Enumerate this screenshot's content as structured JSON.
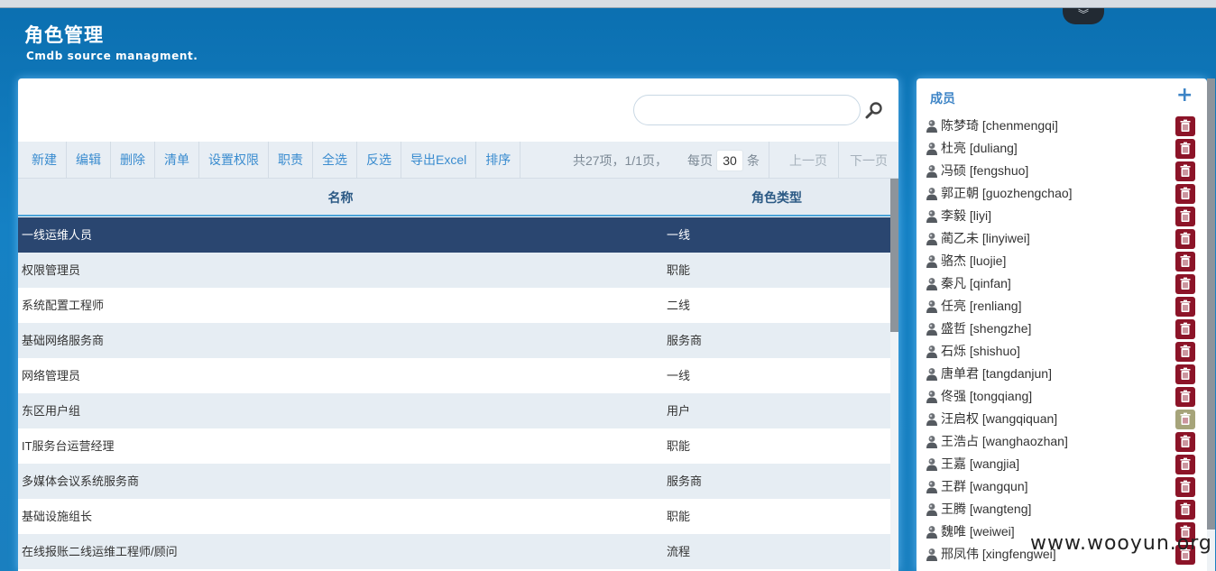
{
  "header": {
    "title": "角色管理",
    "subtitle": "Cmdb source managment."
  },
  "search": {
    "value": "",
    "placeholder": ""
  },
  "toolbar": {
    "buttons": [
      "新建",
      "编辑",
      "删除",
      "清单",
      "设置权限",
      "职责",
      "全选",
      "反选",
      "导出Excel",
      "排序"
    ]
  },
  "pager": {
    "info": "共27项，1/1页，",
    "per_page_label": "每页",
    "per_page_value": "30",
    "per_page_unit": "条",
    "prev": "上一页",
    "next": "下一页"
  },
  "table": {
    "columns": [
      "名称",
      "角色类型"
    ],
    "rows": [
      {
        "name": "一线运维人员",
        "type": "一线"
      },
      {
        "name": "权限管理员",
        "type": "职能"
      },
      {
        "name": "系统配置工程师",
        "type": "二线"
      },
      {
        "name": "基础网络服务商",
        "type": "服务商"
      },
      {
        "name": "网络管理员",
        "type": "一线"
      },
      {
        "name": "东区用户组",
        "type": "用户"
      },
      {
        "name": "IT服务台运营经理",
        "type": "职能"
      },
      {
        "name": "多媒体会议系统服务商",
        "type": "服务商"
      },
      {
        "name": "基础设施组长",
        "type": "职能"
      },
      {
        "name": "在线报账二线运维工程师/顾问",
        "type": "流程"
      }
    ],
    "selected_index": 0
  },
  "members_panel": {
    "title": "成员",
    "members": [
      {
        "name": "陈梦琦 [chenmengqi]",
        "delete_enabled": true
      },
      {
        "name": "杜亮 [duliang]",
        "delete_enabled": true
      },
      {
        "name": "冯硕 [fengshuo]",
        "delete_enabled": true
      },
      {
        "name": "郭正朝 [guozhengchao]",
        "delete_enabled": true
      },
      {
        "name": "李毅 [liyi]",
        "delete_enabled": true
      },
      {
        "name": "蔺乙未 [linyiwei]",
        "delete_enabled": true
      },
      {
        "name": "骆杰 [luojie]",
        "delete_enabled": true
      },
      {
        "name": "秦凡 [qinfan]",
        "delete_enabled": true
      },
      {
        "name": "任亮 [renliang]",
        "delete_enabled": true
      },
      {
        "name": "盛哲 [shengzhe]",
        "delete_enabled": true
      },
      {
        "name": "石烁 [shishuo]",
        "delete_enabled": true
      },
      {
        "name": "唐单君 [tangdanjun]",
        "delete_enabled": true
      },
      {
        "name": "佟强 [tongqiang]",
        "delete_enabled": true
      },
      {
        "name": "汪启权 [wangqiquan]",
        "delete_enabled": false
      },
      {
        "name": "王浩占 [wanghaozhan]",
        "delete_enabled": true
      },
      {
        "name": "王嘉 [wangjia]",
        "delete_enabled": true
      },
      {
        "name": "王群 [wangqun]",
        "delete_enabled": true
      },
      {
        "name": "王腾 [wangteng]",
        "delete_enabled": true
      },
      {
        "name": "魏唯 [weiwei]",
        "delete_enabled": true
      },
      {
        "name": "邢凤伟 [xingfengwei]",
        "delete_enabled": true
      }
    ]
  },
  "watermark": "www.wooyun.org",
  "colors": {
    "header_bg": "#1581c4",
    "accent": "#3a8ccf",
    "selected_row": "#2a4670",
    "delete_button": "#8c1428",
    "delete_button_inactive": "#a6a47a"
  }
}
